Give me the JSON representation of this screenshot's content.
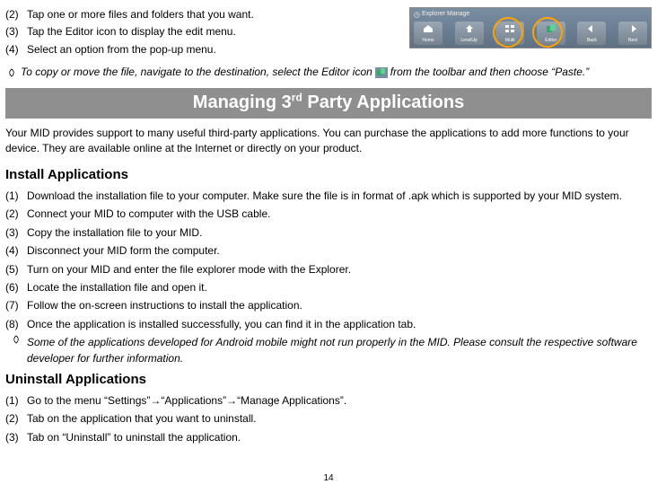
{
  "topSteps": [
    {
      "n": "(2)",
      "t": "Tap one or more files and folders that you want."
    },
    {
      "n": "(3)",
      "t": "Tap the Editor icon to display the edit menu."
    },
    {
      "n": "(4)",
      "t": "Select an option from the pop-up menu."
    }
  ],
  "toolbar": {
    "header": "Explorer Manage",
    "items": [
      "Home",
      "LevelUp",
      "Multi",
      "Editor",
      "Back",
      "Next"
    ]
  },
  "copyNote": {
    "pre": "To copy or move the file, navigate to the destination, select the Editor icon",
    "post": "from the toolbar and then choose “Paste.”"
  },
  "banner": {
    "pre": "Managing 3",
    "sup": "rd",
    "post": " Party Applications"
  },
  "intro": "Your MID provides support to many useful third-party applications. You can purchase the applications to add more functions to your device. They are available online at the Internet or directly on your product.",
  "installHead": "Install Applications",
  "installSteps": [
    {
      "n": "(1)",
      "t": "Download the installation file to your computer. Make sure the file is in format of .apk which is supported by your MID system."
    },
    {
      "n": "(2)",
      "t": "Connect your MID to computer with the USB cable."
    },
    {
      "n": "(3)",
      "t": "Copy the installation file to your MID."
    },
    {
      "n": "(4)",
      "t": "Disconnect your MID form the computer."
    },
    {
      "n": "(5)",
      "t": "Turn on your MID and enter the file explorer mode with the Explorer."
    },
    {
      "n": "(6)",
      "t": "Locate the installation file and open it."
    },
    {
      "n": "(7)",
      "t": "Follow the on-screen instructions to install the application."
    },
    {
      "n": "(8)",
      "t": "Once the application is installed successfully, you can find it in the application tab."
    }
  ],
  "installNote": "Some of the applications developed for Android mobile might not run properly in the MID. Please consult the respective software developer for further information.",
  "uninstallHead": "Uninstall Applications",
  "uninstallSteps": [
    {
      "n": "(1)",
      "t": "Go to the menu “Settings”→“Applications”→“Manage Applications”."
    },
    {
      "n": "(2)",
      "t": "Tab on the application that you want to uninstall."
    },
    {
      "n": "(3)",
      "t": "Tab on “Uninstall” to uninstall the application."
    }
  ],
  "pageNumber": "14"
}
